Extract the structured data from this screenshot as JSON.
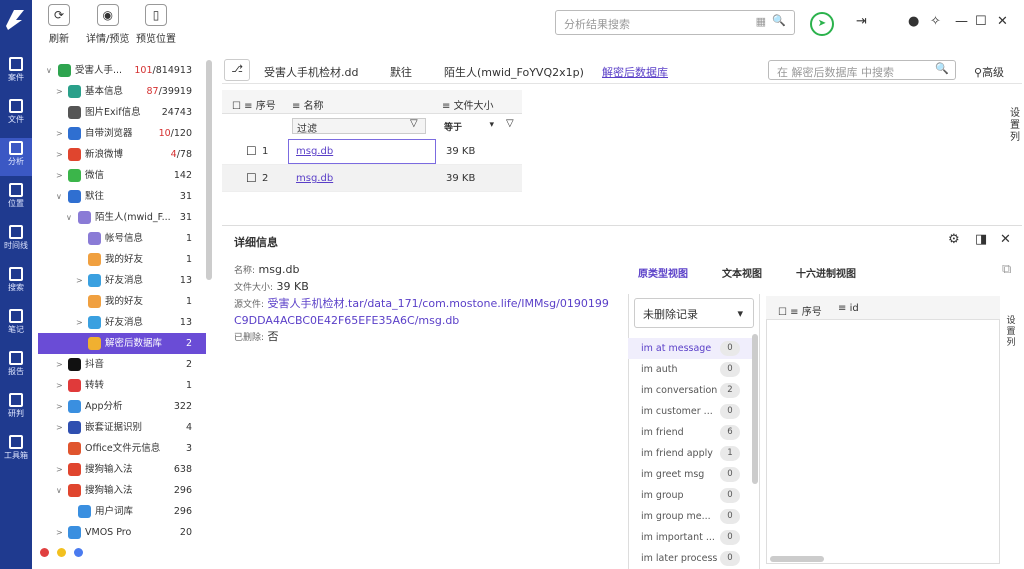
{
  "toolbar": {
    "refresh": "刷新",
    "detail": "详情/预览",
    "preview_pos": "预览位置",
    "search_placeholder": "分析结果搜索"
  },
  "rail": [
    {
      "label": "案件",
      "icon": "file-icon"
    },
    {
      "label": "文件",
      "icon": "folder-icon"
    },
    {
      "label": "分析",
      "icon": "analysis-icon"
    },
    {
      "label": "位置",
      "icon": "location-icon"
    },
    {
      "label": "时间线",
      "icon": "timeline-icon"
    },
    {
      "label": "搜索",
      "icon": "search-icon"
    },
    {
      "label": "笔记",
      "icon": "note-icon"
    },
    {
      "label": "报告",
      "icon": "report-icon"
    },
    {
      "label": "研判",
      "icon": "judge-icon"
    },
    {
      "label": "工具箱",
      "icon": "toolbox-icon"
    }
  ],
  "tree": [
    {
      "label": "受害人手...",
      "count": "101/814913",
      "count_red": "101",
      "indent": 0,
      "exp": "open",
      "color": "#2ea44f"
    },
    {
      "label": "基本信息",
      "count": "87/39919",
      "count_red": "87",
      "indent": 1,
      "exp": "closed",
      "color": "#2aa08a"
    },
    {
      "label": "图片Exif信息",
      "count": "24743",
      "indent": 1,
      "exp": "",
      "color": "#555"
    },
    {
      "label": "自带浏览器",
      "count": "10/120",
      "count_red": "10",
      "indent": 1,
      "exp": "closed",
      "color": "#2f6fd1"
    },
    {
      "label": "新浪微博",
      "count": "4/78",
      "count_red": "4",
      "indent": 1,
      "exp": "closed",
      "color": "#e0452e"
    },
    {
      "label": "微信",
      "count": "142",
      "indent": 1,
      "exp": "closed",
      "color": "#3bb54a"
    },
    {
      "label": "默往",
      "count": "31",
      "indent": 1,
      "exp": "open",
      "color": "#2f6fd1"
    },
    {
      "label": "陌生人(mwid_F...",
      "count": "31",
      "indent": 2,
      "exp": "open",
      "color": "#8a7bd6"
    },
    {
      "label": "帐号信息",
      "count": "1",
      "indent": 3,
      "exp": "",
      "color": "#8a7bd6"
    },
    {
      "label": "我的好友",
      "count": "1",
      "indent": 3,
      "exp": "",
      "color": "#f0a040"
    },
    {
      "label": "好友消息",
      "count": "13",
      "indent": 3,
      "exp": "closed",
      "color": "#3aa0e0"
    },
    {
      "label": "我的好友",
      "count": "1",
      "indent": 3,
      "exp": "",
      "color": "#f0a040"
    },
    {
      "label": "好友消息",
      "count": "13",
      "indent": 3,
      "exp": "closed",
      "color": "#3aa0e0"
    },
    {
      "label": "解密后数据库",
      "count": "2",
      "indent": 3,
      "exp": "",
      "color": "#f0b030",
      "sel": true
    },
    {
      "label": "抖音",
      "count": "2",
      "indent": 1,
      "exp": "closed",
      "color": "#111"
    },
    {
      "label": "转转",
      "count": "1",
      "indent": 1,
      "exp": "closed",
      "color": "#e03a3a"
    },
    {
      "label": "App分析",
      "count": "322",
      "indent": 1,
      "exp": "closed",
      "color": "#3a8fe0"
    },
    {
      "label": "嵌套证据识别",
      "count": "4",
      "indent": 1,
      "exp": "closed",
      "color": "#2f4fb0"
    },
    {
      "label": "Office文件元信息",
      "count": "3",
      "indent": 1,
      "exp": "",
      "color": "#e0552e"
    },
    {
      "label": "搜狗输入法",
      "count": "638",
      "indent": 1,
      "exp": "closed",
      "color": "#e0452e"
    },
    {
      "label": "搜狗输入法",
      "count": "296",
      "indent": 1,
      "exp": "open",
      "color": "#e0452e"
    },
    {
      "label": "用户词库",
      "count": "296",
      "indent": 2,
      "exp": "",
      "color": "#3a8fe0"
    },
    {
      "label": "VMOS Pro",
      "count": "20",
      "indent": 1,
      "exp": "closed",
      "color": "#3a8fe0"
    }
  ],
  "breadcrumb": [
    "受害人手机检材.dd",
    "默往",
    "陌生人(mwid_FoYVQ2x1p)",
    "解密后数据库"
  ],
  "db_search_placeholder": "在 解密后数据库 中搜索",
  "advanced": "高级",
  "grid": {
    "col_index": "序号",
    "col_name": "名称",
    "col_size": "文件大小",
    "filter_placeholder": "过滤",
    "filter_op": "等于",
    "settings": "设置列",
    "rows": [
      {
        "index": "1",
        "name": "msg.db",
        "size": "39 KB"
      },
      {
        "index": "2",
        "name": "msg.db",
        "size": "39 KB"
      }
    ]
  },
  "detail": {
    "title": "详细信息",
    "name_label": "名称:",
    "name": "msg.db",
    "size_label": "文件大小:",
    "size": "39 KB",
    "source_label": "源文件:",
    "source_prefix": "受害人手机检",
    "source_path": "材.tar/data_171/com.mostone.life/IMMsg/0190199C9DDA4ACBC0E42F65EFE35A6C/msg.db",
    "deleted_label": "已删除:",
    "deleted": "否",
    "tabs": [
      "原类型视图",
      "文本视图",
      "十六进制视图"
    ],
    "dropdown": "未删除记录",
    "tables": [
      {
        "n": "im at message",
        "c": "0"
      },
      {
        "n": "im auth",
        "c": "0"
      },
      {
        "n": "im conversation",
        "c": "2"
      },
      {
        "n": "im customer ...",
        "c": "0"
      },
      {
        "n": "im friend",
        "c": "6"
      },
      {
        "n": "im friend apply",
        "c": "1"
      },
      {
        "n": "im greet msg",
        "c": "0"
      },
      {
        "n": "im group",
        "c": "0"
      },
      {
        "n": "im group me...",
        "c": "0"
      },
      {
        "n": "im important ...",
        "c": "0"
      },
      {
        "n": "im later process",
        "c": "0"
      }
    ],
    "sub_col_index": "序号",
    "sub_col_id": "id",
    "sub_settings": "设置列"
  }
}
